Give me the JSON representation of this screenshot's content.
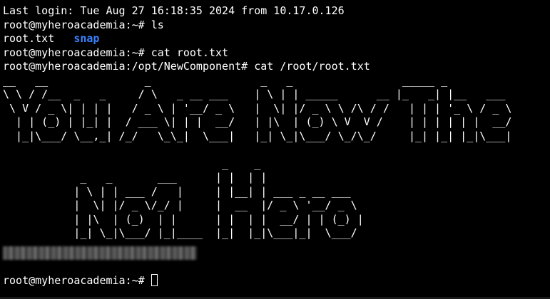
{
  "terminal": {
    "last_login": "Last login: Tue Aug 27 16:18:35 2024 from 10.17.0.126",
    "prompt_home": "root@myheroacademia:~# ",
    "cmd_ls": "ls",
    "ls_file": "root.txt",
    "ls_dir": "snap",
    "cmd_cat": "cat root.txt",
    "prompt_opt": "root@myheroacademia:/opt/NewComponent# ",
    "cmd_cat_abs": "cat /root/root.txt",
    "banner_you_are_now_the": "__   __               _                 _   _                 _____ _          \n\\ \\ / /__  _   _     / \\   _ __ ___    | \\ | | _____      __ |_   _| |__   ___ \n \\ V / _ \\| | | |   / _ \\ | '__/ _ \\   |  \\| |/ _ \\ \\ /\\ / /   | | | '_ \\ / _ \\\n  | | (_) | |_| |  / ___ \\| | |  __/   | |\\  | (_) \\ V  V /    | | | | | |  __/\n  |_|\\___/ \\__,_| /_/   \\_\\_|  \\___|   |_| \\_|\\___/ \\_/\\_/     |_| |_| |_|\\___|",
    "banner_no1_hero": "                                  _    _                \n            _   _       ___      | |  | |               \n           | \\ | | ___ /   |     | |__| | ___ _ __ ___  \n           |  \\| |/ _ \\/_/ |     |  __  |/ _ \\ '__/ _ \\ \n           | |\\  | (_)  | |      | |  | |  __/ | | (_) |\n           |_| \\_|\\___/ |_|____  |_|  |_|\\___|_|  \\___/ ",
    "final_prompt": "root@myheroacademia:~# "
  }
}
